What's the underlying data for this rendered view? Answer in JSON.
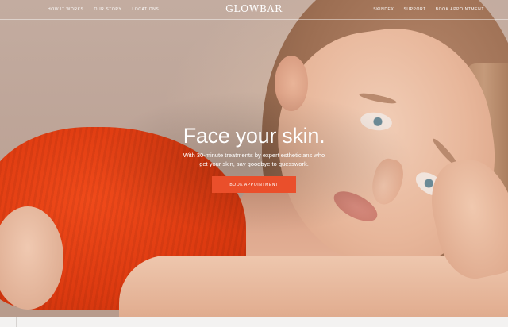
{
  "brand": {
    "logo_text": "GLOWBAR"
  },
  "nav": {
    "left_links": [
      {
        "label": "HOW IT WORKS"
      },
      {
        "label": "OUR STORY"
      },
      {
        "label": "LOCATIONS"
      }
    ],
    "right_links": [
      {
        "label": "SKINDEX"
      },
      {
        "label": "SUPPORT"
      },
      {
        "label": "BOOK APPOINTMENT"
      }
    ]
  },
  "hero": {
    "headline": "Face your skin.",
    "subcopy": "With 30-minute treatments by expert estheticians who get your skin, say goodbye to guesswork.",
    "cta_label": "BOOK APPOINTMENT"
  },
  "colors": {
    "accent": "#ea4f2b",
    "nav_text": "#ffffff",
    "bottom_strip": "#f3f2f1"
  }
}
